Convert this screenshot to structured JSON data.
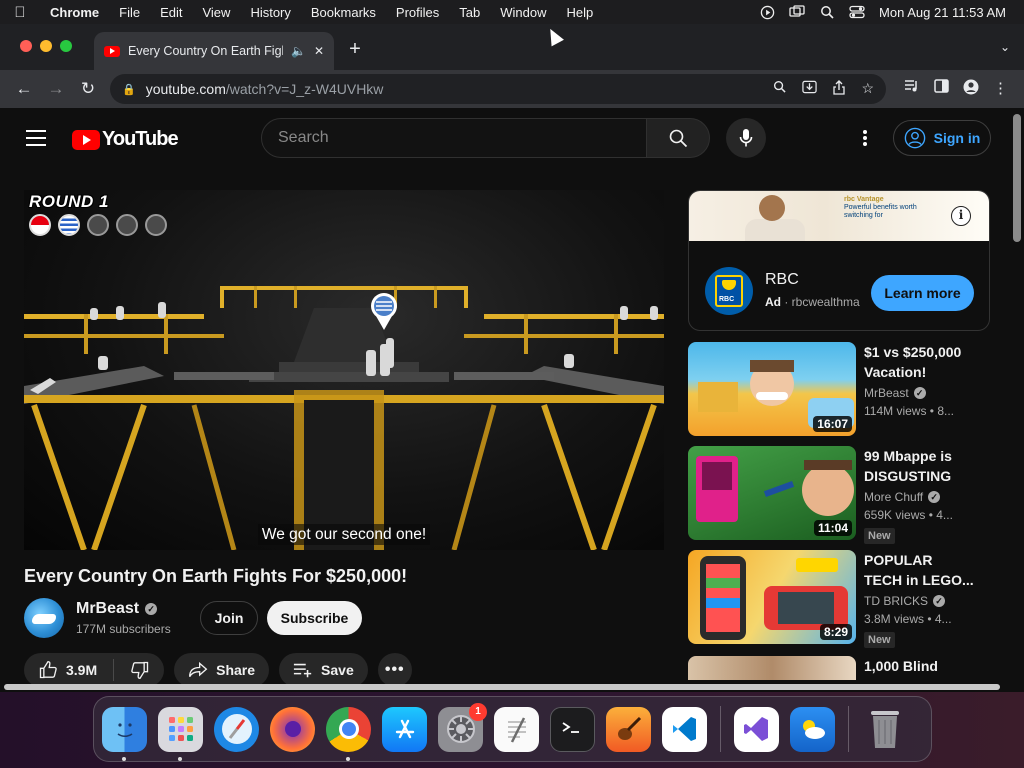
{
  "menubar": {
    "app": "Chrome",
    "items": [
      "File",
      "Edit",
      "View",
      "History",
      "Bookmarks",
      "Profiles",
      "Tab",
      "Window",
      "Help"
    ],
    "datetime": "Mon Aug 21  11:53 AM"
  },
  "browser": {
    "tab_title": "Every Country On Earth Fights For $250,000!",
    "url_host": "youtube.com",
    "url_path": "/watch?v=J_z-W4UVHkw"
  },
  "youtube": {
    "logo_text": "YouTube",
    "search_placeholder": "Search",
    "sign_in": "Sign in",
    "player": {
      "overlay_round": "ROUND 1",
      "caption": "We got our second one!"
    },
    "video": {
      "title": "Every Country On Earth Fights For $250,000!",
      "channel": "MrBeast",
      "subscribers": "177M subscribers",
      "join": "Join",
      "subscribe": "Subscribe",
      "likes": "3.9M",
      "share": "Share",
      "save": "Save"
    },
    "ad": {
      "advertiser": "RBC",
      "label": "Ad",
      "domain": "rbcwealthma",
      "cta": "Learn more",
      "banner_text": "Powerful benefits worth switching for",
      "banner_brand": "rbc Vantage",
      "logo_text": "RBC"
    },
    "recommendations": [
      {
        "title": "$1 vs $250,000 Vacation!",
        "channel": "MrBeast",
        "meta": "114M views • 8...",
        "duration": "16:07",
        "badge": ""
      },
      {
        "title": "99 Mbappe is DISGUSTING",
        "channel": "More Chuff",
        "meta": "659K views • 4...",
        "duration": "11:04",
        "badge": "New"
      },
      {
        "title": "POPULAR TECH in LEGO...",
        "channel": "TD BRICKS",
        "meta": "3.8M views • 4...",
        "duration": "8:29",
        "badge": "New"
      },
      {
        "title": "1,000 Blind",
        "channel": "",
        "meta": "",
        "duration": "",
        "badge": ""
      }
    ]
  },
  "dock": {
    "apps": [
      "Finder",
      "Launchpad",
      "Safari",
      "Firefox",
      "Chrome",
      "App Store",
      "System Settings",
      "TextEdit",
      "Terminal",
      "GarageBand",
      "VS Code",
      "Visual Studio",
      "Weather",
      "Trash"
    ],
    "settings_badge": "1"
  }
}
